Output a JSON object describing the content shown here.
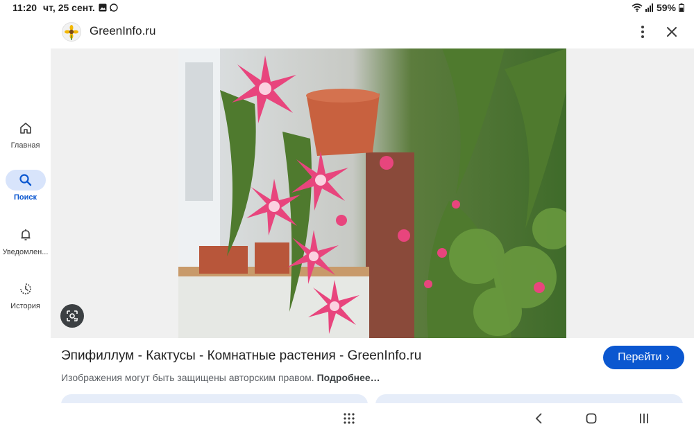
{
  "status_bar": {
    "time": "11:20",
    "date": "чт, 25 сент.",
    "battery": "59%",
    "icons": [
      "gallery-icon",
      "whatsapp-icon",
      "wifi-icon",
      "signal-icon",
      "battery-icon"
    ]
  },
  "rail": {
    "items": [
      {
        "label": "Главная",
        "icon": "home-icon"
      },
      {
        "label": "Поиск",
        "icon": "search-icon",
        "active": true
      },
      {
        "label": "Уведомлен...",
        "icon": "bell-icon"
      },
      {
        "label": "История",
        "icon": "history-icon"
      }
    ]
  },
  "header": {
    "site_title": "GreenInfo.ru",
    "favicon": "sunflower-icon"
  },
  "result": {
    "title": "Эпифиллум - Кактусы - Комнатные растения - GreenInfo.ru",
    "copyright_text": "Изображения могут быть защищены авторским правом.",
    "more_link": "Подробнее…",
    "goto_label": "Перейти"
  },
  "colors": {
    "accent": "#0b57d0",
    "rail_active_bg": "#d8e4fb",
    "chip_bg": "#e6edf9"
  }
}
